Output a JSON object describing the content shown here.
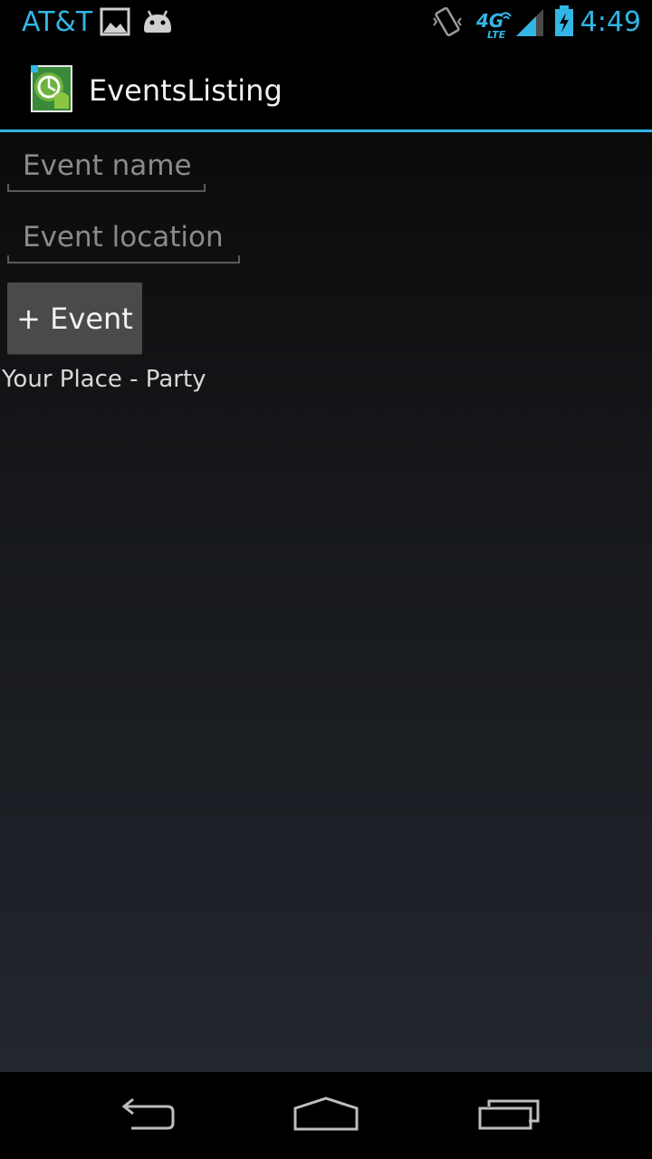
{
  "status_bar": {
    "carrier": "AT&T",
    "time": "4:49",
    "network": "4G LTE",
    "accent_color": "#33b5e5",
    "icons": [
      "image-icon",
      "android-icon",
      "vibrate-icon",
      "4g-lte-icon",
      "signal-icon",
      "battery-charging-icon"
    ]
  },
  "action_bar": {
    "title": "EventsListing",
    "icon": "app-launcher-icon"
  },
  "form": {
    "event_name_placeholder": "Event name",
    "event_location_placeholder": "Event location",
    "add_button_label": "+ Event"
  },
  "events": [
    {
      "text": "Your Place - Party"
    }
  ],
  "nav_bar": {
    "icons": [
      "back-icon",
      "home-icon",
      "recent-apps-icon"
    ]
  }
}
